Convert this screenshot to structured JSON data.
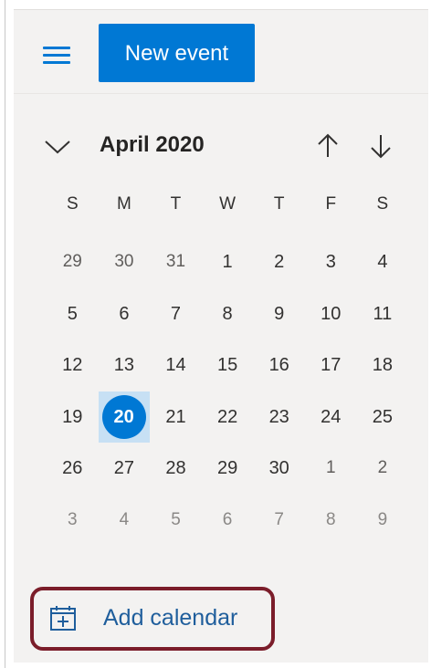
{
  "toolbar": {
    "menu_icon": "hamburger-icon",
    "new_event_label": "New event"
  },
  "calendar": {
    "month_title": "April 2020",
    "collapse_icon": "chevron-down-icon",
    "prev_icon": "arrow-up-icon",
    "next_icon": "arrow-down-icon",
    "weekdays": [
      "S",
      "M",
      "T",
      "W",
      "T",
      "F",
      "S"
    ],
    "weeks": [
      [
        "29",
        "30",
        "31",
        "1",
        "2",
        "3",
        "4"
      ],
      [
        "5",
        "6",
        "7",
        "8",
        "9",
        "10",
        "11"
      ],
      [
        "12",
        "13",
        "14",
        "15",
        "16",
        "17",
        "18"
      ],
      [
        "19",
        "20",
        "21",
        "22",
        "23",
        "24",
        "25"
      ],
      [
        "26",
        "27",
        "28",
        "29",
        "30",
        "1",
        "2"
      ],
      [
        "3",
        "4",
        "5",
        "6",
        "7",
        "8",
        "9"
      ]
    ],
    "today": "20"
  },
  "sidebar": {
    "add_calendar_label": "Add calendar",
    "add_calendar_icon": "add-calendar-icon"
  },
  "colors": {
    "accent": "#0078d4",
    "highlight_border": "#7b1d2a",
    "selected_cell": "#c7e0f4",
    "link_text": "#1f5e9c"
  }
}
